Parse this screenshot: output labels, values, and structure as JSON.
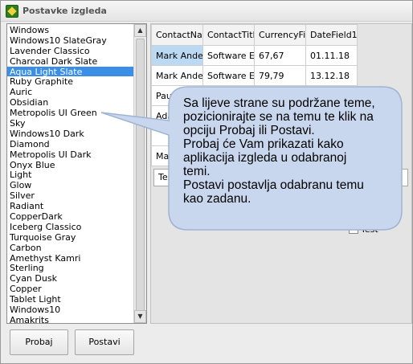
{
  "window": {
    "title": "Postavke izgleda"
  },
  "themes": {
    "items": [
      "Windows",
      "Windows10 SlateGray",
      "Lavender Classico",
      "Charcoal Dark Slate",
      "Aqua Light Slate",
      "Ruby Graphite",
      "Auric",
      "Obsidian",
      "Metropolis UI Green",
      "Sky",
      "Windows10 Dark",
      "Diamond",
      "Metropolis UI Dark",
      "Onyx Blue",
      "Light",
      "Glow",
      "Silver",
      "Radiant",
      "CopperDark",
      "Iceberg Classico",
      "Turquoise Gray",
      "Carbon",
      "Amethyst Kamri",
      "Sterling",
      "Cyan Dusk",
      "Copper",
      "Tablet Light",
      "Windows10",
      "Amakrits"
    ],
    "selected": "Aqua Light Slate"
  },
  "grid": {
    "columns": [
      "ContactNam",
      "ContactTitle",
      "CurrencyFie",
      "DateField1"
    ],
    "rows": [
      [
        "Mark Anders",
        "Software En",
        "67,67",
        "01.11.18"
      ],
      [
        "Mark Anders",
        "Software En",
        "79,79",
        "13.12.18"
      ],
      [
        "Paul D",
        "",
        "",
        ""
      ],
      [
        "Ada",
        "",
        "",
        ""
      ],
      [
        "",
        "",
        "",
        ""
      ],
      [
        "Mar",
        "",
        "",
        ""
      ]
    ]
  },
  "preview": {
    "input_value": "Tes",
    "checkbox_label": "Test"
  },
  "buttons": {
    "try": "Probaj",
    "set": "Postavi"
  },
  "callout": {
    "lines": [
      "Sa lijeve strane su podržane teme,",
      "pozicionirajte se na temu te klik na",
      "opciju Probaj ili Postavi.",
      "Probaj će Vam prikazati kako",
      "aplikacija izgleda u odabranoj",
      "temi.",
      "Postavi postavlja odabranu temu",
      "kao zadanu."
    ],
    "fill": "#c9d7ee",
    "stroke": "#9fb3d4"
  }
}
